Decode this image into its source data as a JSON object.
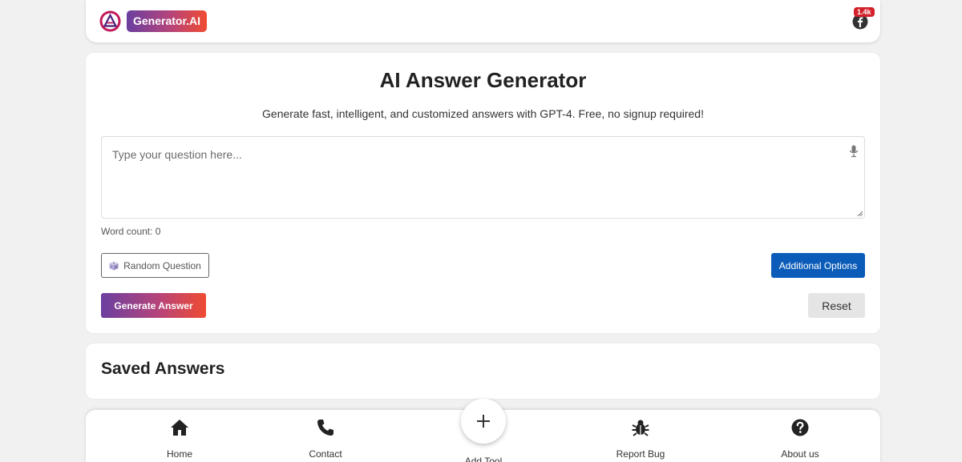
{
  "header": {
    "brand": "Generator.AI",
    "social_count": "1.4k",
    "logo_icon": "triangle-logo-icon",
    "social_icon": "facebook-icon"
  },
  "main": {
    "title": "AI Answer Generator",
    "subtitle": "Generate fast, intelligent, and customized answers with GPT-4. Free, no signup required!",
    "question": {
      "value": "",
      "placeholder": "Type your question here..."
    },
    "word_count_label": "Word count: 0",
    "random_question_label": "Random Question",
    "additional_options_label": "Additional Options",
    "generate_label": "Generate Answer",
    "reset_label": "Reset"
  },
  "saved": {
    "title": "Saved Answers"
  },
  "bottom_nav": {
    "home": "Home",
    "contact": "Contact",
    "add_tool": "Add Tool",
    "report_bug": "Report Bug",
    "about": "About us"
  },
  "colors": {
    "brand_gradient_start": "#6a3fa0",
    "brand_gradient_end": "#f04b32",
    "primary_blue": "#0b5cb8",
    "badge_red": "#d4202a"
  }
}
